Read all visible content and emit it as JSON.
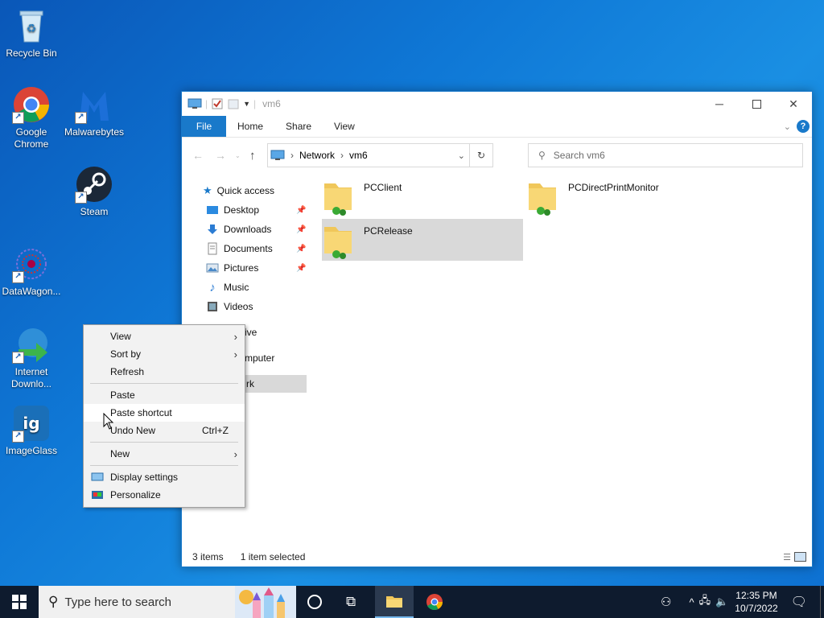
{
  "desktop": {
    "icons": [
      {
        "label": "Recycle Bin"
      },
      {
        "label": "Google Chrome"
      },
      {
        "label": "Malwarebytes"
      },
      {
        "label": "Steam"
      },
      {
        "label": "DataWagon..."
      },
      {
        "label": "Internet Downlo..."
      },
      {
        "label": "ImageGlass"
      }
    ]
  },
  "explorer": {
    "title": "vm6",
    "ribbon_tabs": [
      "File",
      "Home",
      "Share",
      "View"
    ],
    "breadcrumb": [
      "Network",
      "vm6"
    ],
    "search_placeholder": "Search vm6",
    "nav": {
      "quick_access": "Quick access",
      "items": [
        {
          "label": "Desktop",
          "icon": "desktop-icon",
          "pinned": true
        },
        {
          "label": "Downloads",
          "icon": "downloads-icon",
          "pinned": true
        },
        {
          "label": "Documents",
          "icon": "documents-icon",
          "pinned": true
        },
        {
          "label": "Pictures",
          "icon": "pictures-icon",
          "pinned": true
        },
        {
          "label": "Music",
          "icon": "music-icon",
          "pinned": false
        },
        {
          "label": "Videos",
          "icon": "videos-icon",
          "pinned": false
        }
      ],
      "partial": [
        "ive",
        "mputer",
        "rk"
      ]
    },
    "folders": [
      {
        "name": "PCClient",
        "selected": false
      },
      {
        "name": "PCDirectPrintMonitor",
        "selected": false
      },
      {
        "name": "PCRelease",
        "selected": true
      }
    ],
    "status": {
      "count": "3 items",
      "selection": "1 item selected"
    }
  },
  "context_menu": {
    "items": [
      {
        "label": "View",
        "submenu": true
      },
      {
        "label": "Sort by",
        "submenu": true
      },
      {
        "label": "Refresh"
      },
      {
        "label": "Paste"
      },
      {
        "label": "Paste shortcut",
        "hovered": true
      },
      {
        "label": "Undo New",
        "shortcut": "Ctrl+Z"
      },
      {
        "label": "New",
        "submenu": true
      },
      {
        "label": "Display settings",
        "icon": "display-settings-icon"
      },
      {
        "label": "Personalize",
        "icon": "personalize-icon"
      }
    ]
  },
  "taskbar": {
    "search_placeholder": "Type here to search",
    "time": "12:35 PM",
    "date": "10/7/2022"
  },
  "colors": {
    "accent": "#1979ca",
    "selection": "#d9d9d9",
    "taskbar": "#0e1b2e"
  }
}
